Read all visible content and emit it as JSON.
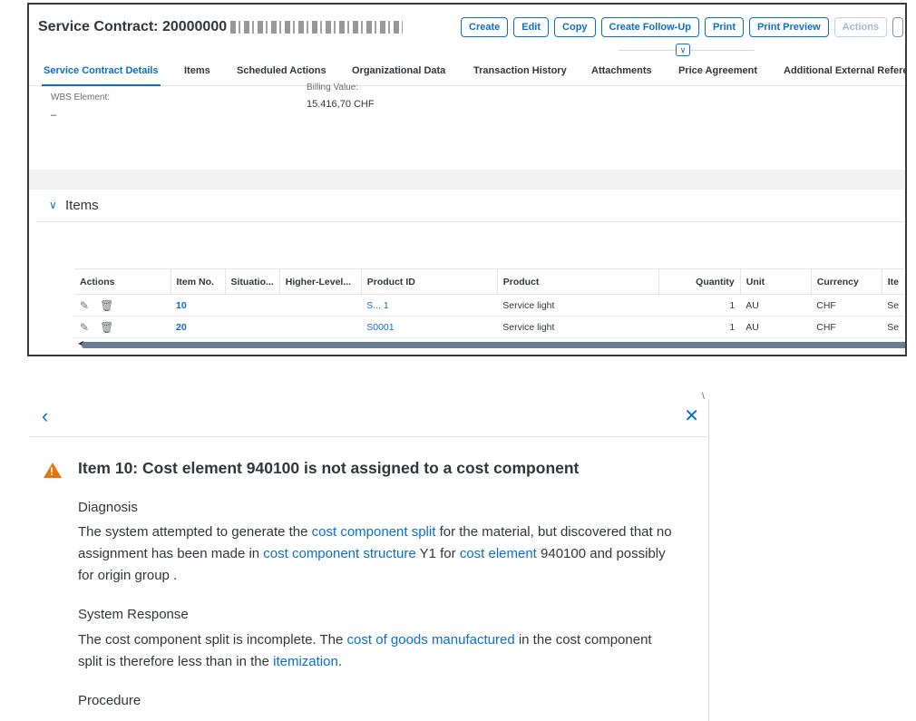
{
  "header": {
    "title": "Service Contract: 20000000"
  },
  "toolbar": {
    "create": "Create",
    "edit": "Edit",
    "copy": "Copy",
    "follow_up": "Create Follow-Up",
    "print": "Print",
    "print_preview": "Print Preview",
    "actions": "Actions"
  },
  "tabs": [
    "Service Contract Details",
    "Items",
    "Scheduled Actions",
    "Organizational Data",
    "Transaction History",
    "Attachments",
    "Price Agreement",
    "Additional External Refere"
  ],
  "details": {
    "wbs_label": "WBS Element:",
    "wbs_value": "–",
    "billing_label": "Billing Value:",
    "billing_value": "15.416,70   CHF"
  },
  "items_section": {
    "title": "Items",
    "columns": [
      "Actions",
      "Item No.",
      "Situatio...",
      "Higher-Level...",
      "Product ID",
      "Product",
      "Quantity",
      "Unit",
      "Currency",
      "Ite"
    ],
    "rows": [
      {
        "item_no": "10",
        "product_id": "S... 1",
        "product": "Service light",
        "quantity": "1",
        "unit": "AU",
        "currency": "CHF",
        "item_type": "Se"
      },
      {
        "item_no": "20",
        "product_id": "S0001",
        "product": "Service light",
        "quantity": "1",
        "unit": "AU",
        "currency": "CHF",
        "item_type": "Se"
      }
    ]
  },
  "message": {
    "title": "Item 10: Cost element 940100 is not assigned to a cost component",
    "diagnosis_h": "Diagnosis",
    "diag_1": "The system attempted to generate the ",
    "diag_link1": "cost component split",
    "diag_2": " for the material, but discovered that no assignment has been made in ",
    "diag_link2": "cost component structure",
    "diag_3": " Y1 for ",
    "diag_link3": "cost element",
    "diag_4": " 940100 and possibly for origin group .",
    "response_h": "System Response",
    "resp_1": "The cost component split is incomplete. The ",
    "resp_link1": "cost of goods manufactured",
    "resp_2": " in the cost component split is therefore less than in the ",
    "resp_link2": "itemization",
    "resp_3": ".",
    "procedure_h": "Procedure"
  },
  "colors": {
    "accent": "#0a6ed1",
    "warning": "#e9730c"
  },
  "icons": [
    "back-icon",
    "close-icon",
    "warning-icon",
    "edit-icon",
    "delete-icon",
    "chevron-down-icon"
  ]
}
